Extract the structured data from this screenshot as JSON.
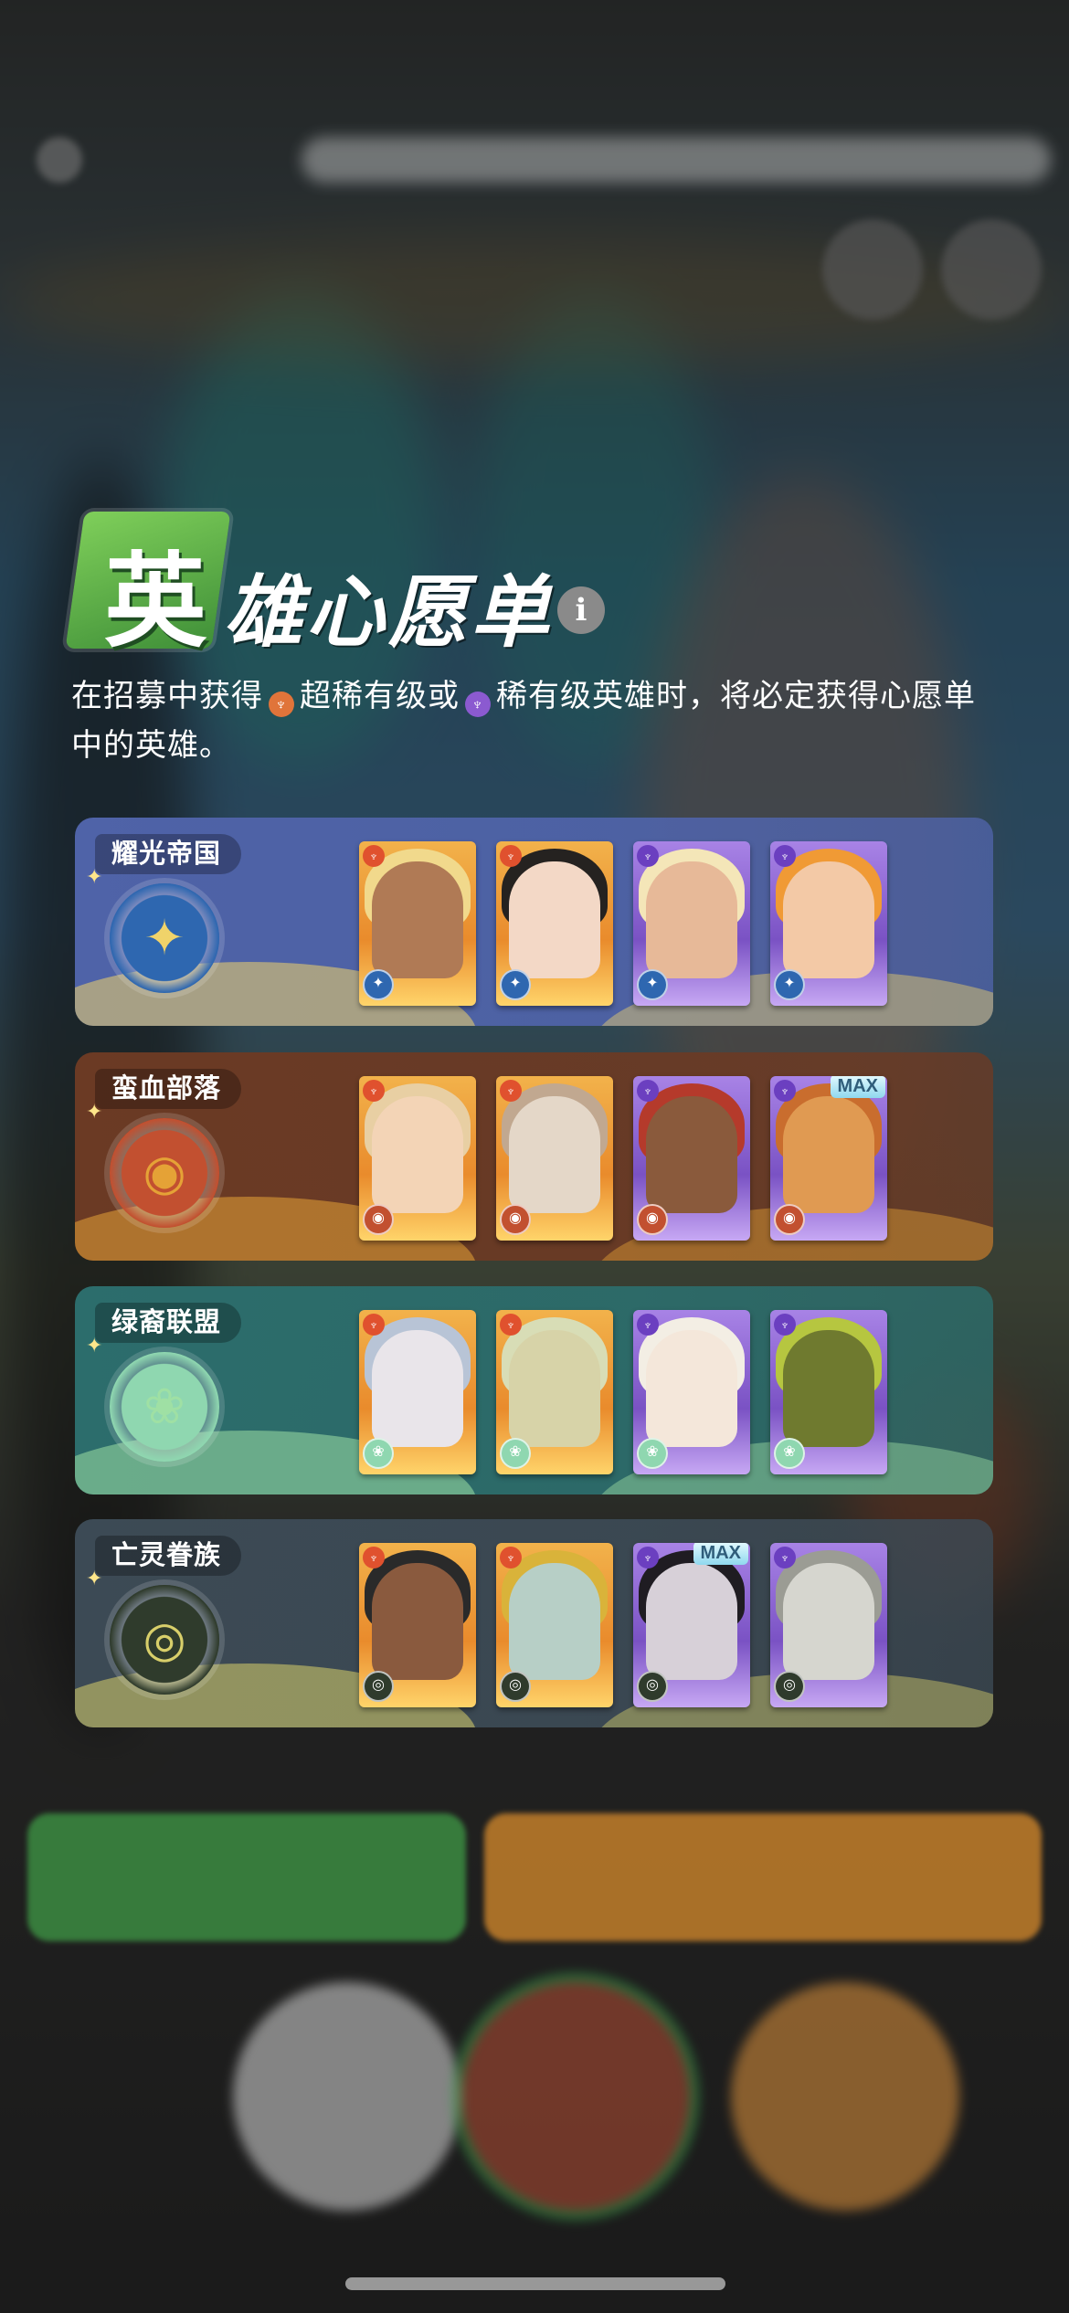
{
  "title": {
    "first_char": "英",
    "rest": "雄心愿单",
    "info_icon": "i"
  },
  "description": {
    "part1": "在招募中获得",
    "super_rare_label": "超稀有级",
    "part2": "或",
    "rare_label": "稀有级英雄时，将必定获得心愿单中的英雄。"
  },
  "factions": [
    {
      "name": "耀光帝国",
      "icon": "compass-star-icon",
      "glyph": "✦",
      "colors": {
        "panel": "#4f63a8",
        "accent": "#f0d36a",
        "emblem": "#2e67b0"
      },
      "heroes": [
        {
          "rarity": "super",
          "skin": "#b07a55",
          "hair": "#f1d98c"
        },
        {
          "rarity": "super",
          "skin": "#f3d8c6",
          "hair": "#252220"
        },
        {
          "rarity": "rare",
          "skin": "#e7b998",
          "hair": "#f4e6b8"
        },
        {
          "rarity": "rare",
          "skin": "#f3c9a6",
          "hair": "#f09a35"
        }
      ]
    },
    {
      "name": "蛮血部落",
      "icon": "target-icon",
      "glyph": "◉",
      "colors": {
        "panel": "#6b3a24",
        "accent": "#e5a236",
        "emblem": "#c25030"
      },
      "heroes": [
        {
          "rarity": "super",
          "skin": "#f3d4b6",
          "hair": "#e8cfa3"
        },
        {
          "rarity": "super",
          "skin": "#e4d7c8",
          "hair": "#c1a890"
        },
        {
          "rarity": "rare",
          "skin": "#8a5a3c",
          "hair": "#b53a2b"
        },
        {
          "rarity": "rare",
          "skin": "#e09a52",
          "hair": "#c96d2e",
          "max": "MAX"
        }
      ]
    },
    {
      "name": "绿裔联盟",
      "icon": "lotus-icon",
      "glyph": "❀",
      "colors": {
        "panel": "#2c6d6c",
        "accent": "#9fe0a4",
        "emblem": "#8fd7b0"
      },
      "heroes": [
        {
          "rarity": "super",
          "skin": "#e9e5ea",
          "hair": "#b8c4d6"
        },
        {
          "rarity": "super",
          "skin": "#d7d3a8",
          "hair": "#d8ddb6"
        },
        {
          "rarity": "rare",
          "skin": "#f4e7da",
          "hair": "#f3eee4"
        },
        {
          "rarity": "rare",
          "skin": "#6f7a2f",
          "hair": "#b6c640"
        }
      ]
    },
    {
      "name": "亡灵眷族",
      "icon": "eye-icon",
      "glyph": "◎",
      "colors": {
        "panel": "#3c4a55",
        "accent": "#d8cf6a",
        "emblem": "#2f3b2c"
      },
      "heroes": [
        {
          "rarity": "super",
          "skin": "#8a5a3e",
          "hair": "#2a2a2a"
        },
        {
          "rarity": "super",
          "skin": "#b7cfc6",
          "hair": "#d9b33a"
        },
        {
          "rarity": "rare",
          "skin": "#d7d0d8",
          "hair": "#1f1c22",
          "max": "MAX"
        },
        {
          "rarity": "rare",
          "skin": "#d6d6cf",
          "hair": "#9b9c94"
        }
      ]
    }
  ]
}
